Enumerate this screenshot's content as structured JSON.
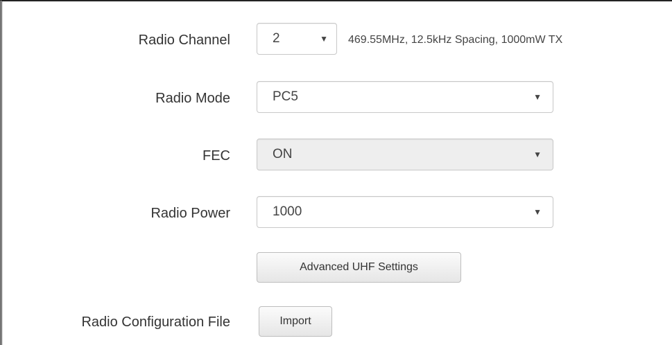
{
  "form": {
    "radio_channel": {
      "label": "Radio Channel",
      "value": "2",
      "description": "469.55MHz, 12.5kHz Spacing, 1000mW TX"
    },
    "radio_mode": {
      "label": "Radio Mode",
      "value": "PC5"
    },
    "fec": {
      "label": "FEC",
      "value": "ON",
      "disabled": true
    },
    "radio_power": {
      "label": "Radio Power",
      "value": "1000"
    },
    "advanced_button": {
      "label": "Advanced UHF Settings"
    },
    "config_file": {
      "label": "Radio Configuration File",
      "import_label": "Import"
    }
  },
  "icons": {
    "dropdown": "chevron-down-icon"
  },
  "colors": {
    "disabled_bg": "#eeeeee",
    "border": "#c8c8c8",
    "text": "#333333"
  }
}
